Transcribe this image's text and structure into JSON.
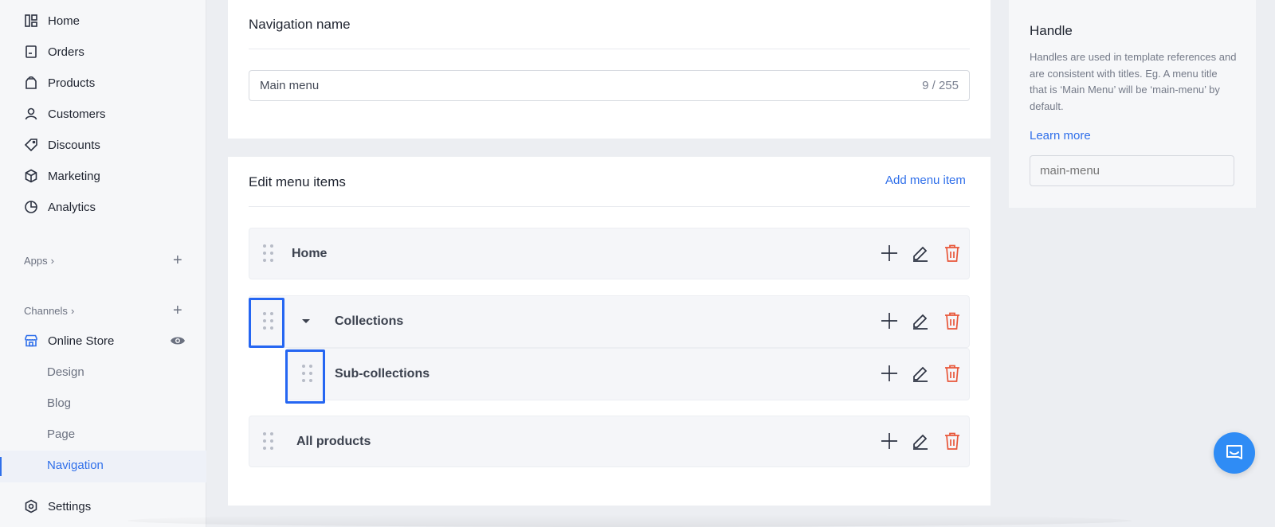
{
  "sidebar": {
    "items": [
      {
        "label": "Home",
        "icon": "home-icon"
      },
      {
        "label": "Orders",
        "icon": "orders-icon"
      },
      {
        "label": "Products",
        "icon": "products-icon"
      },
      {
        "label": "Customers",
        "icon": "customers-icon"
      },
      {
        "label": "Discounts",
        "icon": "discounts-icon"
      },
      {
        "label": "Marketing",
        "icon": "marketing-icon"
      },
      {
        "label": "Analytics",
        "icon": "analytics-icon"
      }
    ],
    "apps_label": "Apps",
    "channels_label": "Channels",
    "online_store_label": "Online Store",
    "sub_items": [
      "Design",
      "Blog",
      "Page",
      "Navigation"
    ],
    "active_sub_item": "Navigation",
    "settings_label": "Settings"
  },
  "nav_name_card": {
    "title": "Navigation name",
    "input_value": "Main menu",
    "counter": "9 / 255"
  },
  "menu_card": {
    "title": "Edit menu items",
    "add_label": "Add menu item",
    "items": [
      {
        "label": "Home"
      },
      {
        "label": "Collections"
      },
      {
        "label": "Sub-collections"
      },
      {
        "label": "All products"
      }
    ]
  },
  "handle_card": {
    "title": "Handle",
    "description": "Handles are used in template references and are consistent with titles. Eg. A menu title that is ‘Main Menu’ will be ‘main-menu’ by default.",
    "learn_more": "Learn more",
    "placeholder": "main-menu"
  },
  "colors": {
    "accent": "#2f6fea",
    "highlight": "#2566f2",
    "delete": "#e8573a",
    "chat": "#2f8cf5"
  }
}
